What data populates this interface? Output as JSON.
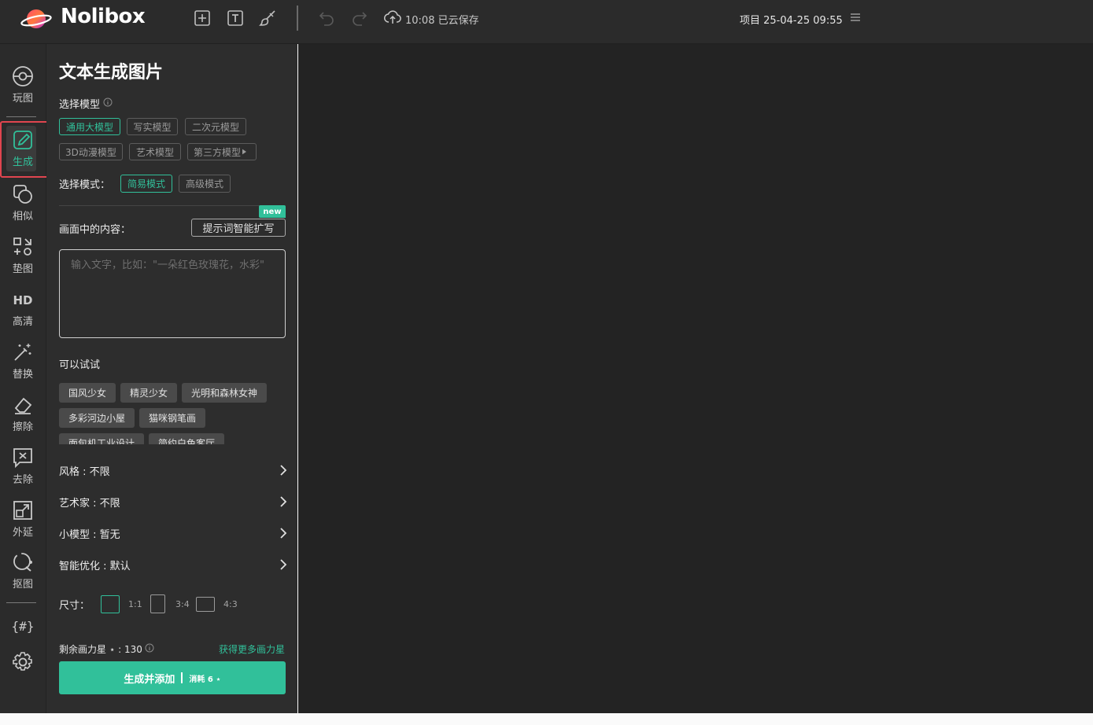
{
  "app": {
    "brand": "Nolibox",
    "save_status": "10:08 已云保存",
    "project_title": "项目 25-04-25 09:55"
  },
  "toolbar": {
    "icons": [
      "add-square-icon",
      "text-box-icon",
      "brush-icon",
      "undo-icon",
      "redo-icon",
      "cloud-upload-icon",
      "menu-icon"
    ]
  },
  "sidebar": {
    "items": [
      {
        "label": "玩图",
        "icon": "play-disc-icon"
      },
      {
        "label": "生成",
        "icon": "generate-pencil-icon",
        "active": true
      },
      {
        "label": "相似",
        "icon": "similar-icon"
      },
      {
        "label": "垫图",
        "icon": "pad-image-icon"
      },
      {
        "label": "高清",
        "icon": "hd-icon"
      },
      {
        "label": "替换",
        "icon": "replace-wand-icon"
      },
      {
        "label": "擦除",
        "icon": "eraser-icon"
      },
      {
        "label": "去除",
        "icon": "remove-icon"
      },
      {
        "label": "外延",
        "icon": "outpaint-icon"
      },
      {
        "label": "抠图",
        "icon": "cutout-icon"
      }
    ],
    "extra_icons": [
      "hash-braces-icon",
      "settings-gear-icon"
    ]
  },
  "panel": {
    "title": "文本生成图片",
    "model_label": "选择模型",
    "models": [
      "通用大模型",
      "写实模型",
      "二次元模型",
      "3D动漫模型",
      "艺术模型",
      "第三方模型"
    ],
    "selected_model": "通用大模型",
    "mode_label": "选择模式：",
    "modes": [
      "简易模式",
      "高级模式"
    ],
    "selected_mode": "简易模式",
    "content_label": "画面中的内容：",
    "new_badge": "new",
    "expand_button": "提示词智能扩写",
    "prompt_placeholder": "输入文字，比如：\"一朵红色玫瑰花，水彩\"",
    "prompt_value": "",
    "try_label": "可以试试",
    "suggestions": [
      "国风少女",
      "精灵少女",
      "光明和森林女神",
      "多彩河边小屋",
      "猫咪钢笔画",
      "面包机工业设计",
      "简约白色客厅"
    ],
    "settings": [
      {
        "label": "风格 : 不限"
      },
      {
        "label": "艺术家 : 不限"
      },
      {
        "label": "小模型 : 暂无"
      },
      {
        "label": "智能优化 : 默认"
      }
    ],
    "size_label": "尺寸：",
    "ratios": [
      "1:1",
      "3:4",
      "4:3"
    ],
    "selected_ratio": "1:1",
    "credits_text": "剩余画力星 ⋆ : 130",
    "more_credits": "获得更多画力星",
    "generate_button": "生成并添加",
    "generate_cost": "消耗 6 ⋆"
  },
  "colors": {
    "accent": "#31c09a",
    "highlight_frame": "#e0454f",
    "panel_bg": "#2d2d2d",
    "canvas_bg": "#232323"
  }
}
